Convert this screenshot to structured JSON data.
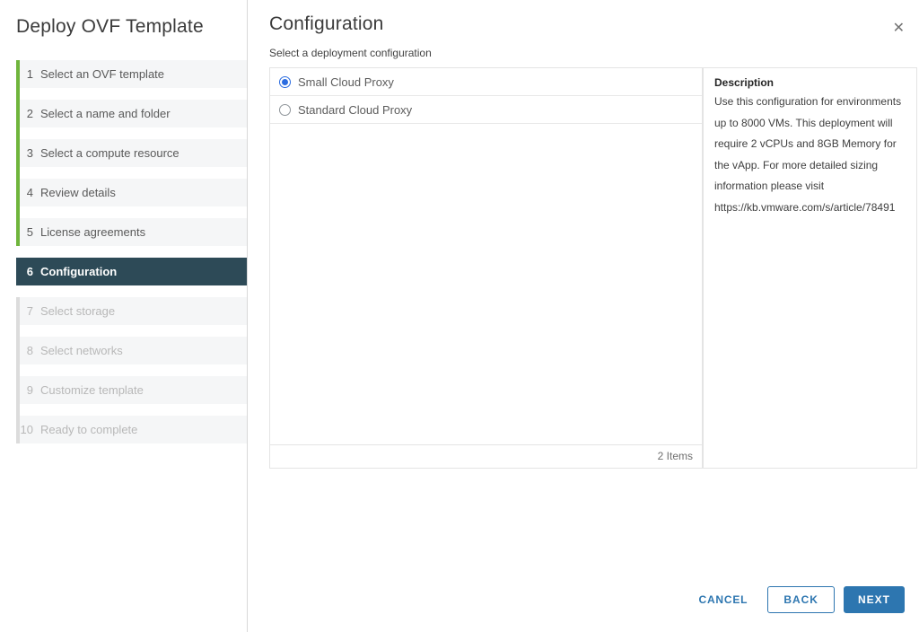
{
  "wizard": {
    "title": "Deploy OVF Template"
  },
  "sidebar": {
    "steps": [
      {
        "number": "1",
        "label": "Select an OVF template",
        "status": "completed"
      },
      {
        "number": "2",
        "label": "Select a name and folder",
        "status": "completed"
      },
      {
        "number": "3",
        "label": "Select a compute resource",
        "status": "completed"
      },
      {
        "number": "4",
        "label": "Review details",
        "status": "completed"
      },
      {
        "number": "5",
        "label": "License agreements",
        "status": "completed"
      },
      {
        "number": "6",
        "label": "Configuration",
        "status": "active"
      },
      {
        "number": "7",
        "label": "Select storage",
        "status": "future"
      },
      {
        "number": "8",
        "label": "Select networks",
        "status": "future"
      },
      {
        "number": "9",
        "label": "Customize template",
        "status": "future"
      },
      {
        "number": "10",
        "label": "Ready to complete",
        "status": "future"
      }
    ]
  },
  "main": {
    "title": "Configuration",
    "subtitle": "Select a deployment configuration",
    "options": [
      {
        "label": "Small Cloud Proxy",
        "selected": true
      },
      {
        "label": "Standard Cloud Proxy",
        "selected": false
      }
    ],
    "items_count": "2 Items",
    "description": {
      "heading": "Description",
      "text": "Use this configuration for environments up to 8000 VMs. This deployment will require 2 vCPUs and 8GB Memory for the vApp. For more detailed sizing information please visit https://kb.vmware.com/s/article/78491"
    }
  },
  "footer": {
    "cancel_label": "CANCEL",
    "back_label": "BACK",
    "next_label": "NEXT"
  },
  "icons": {
    "close": "✕"
  },
  "colors": {
    "accent_blue": "#2d76b0",
    "radio_blue": "#2b6ce0",
    "completed_green": "#6fb53c",
    "active_step_bg": "#2d4a57"
  }
}
